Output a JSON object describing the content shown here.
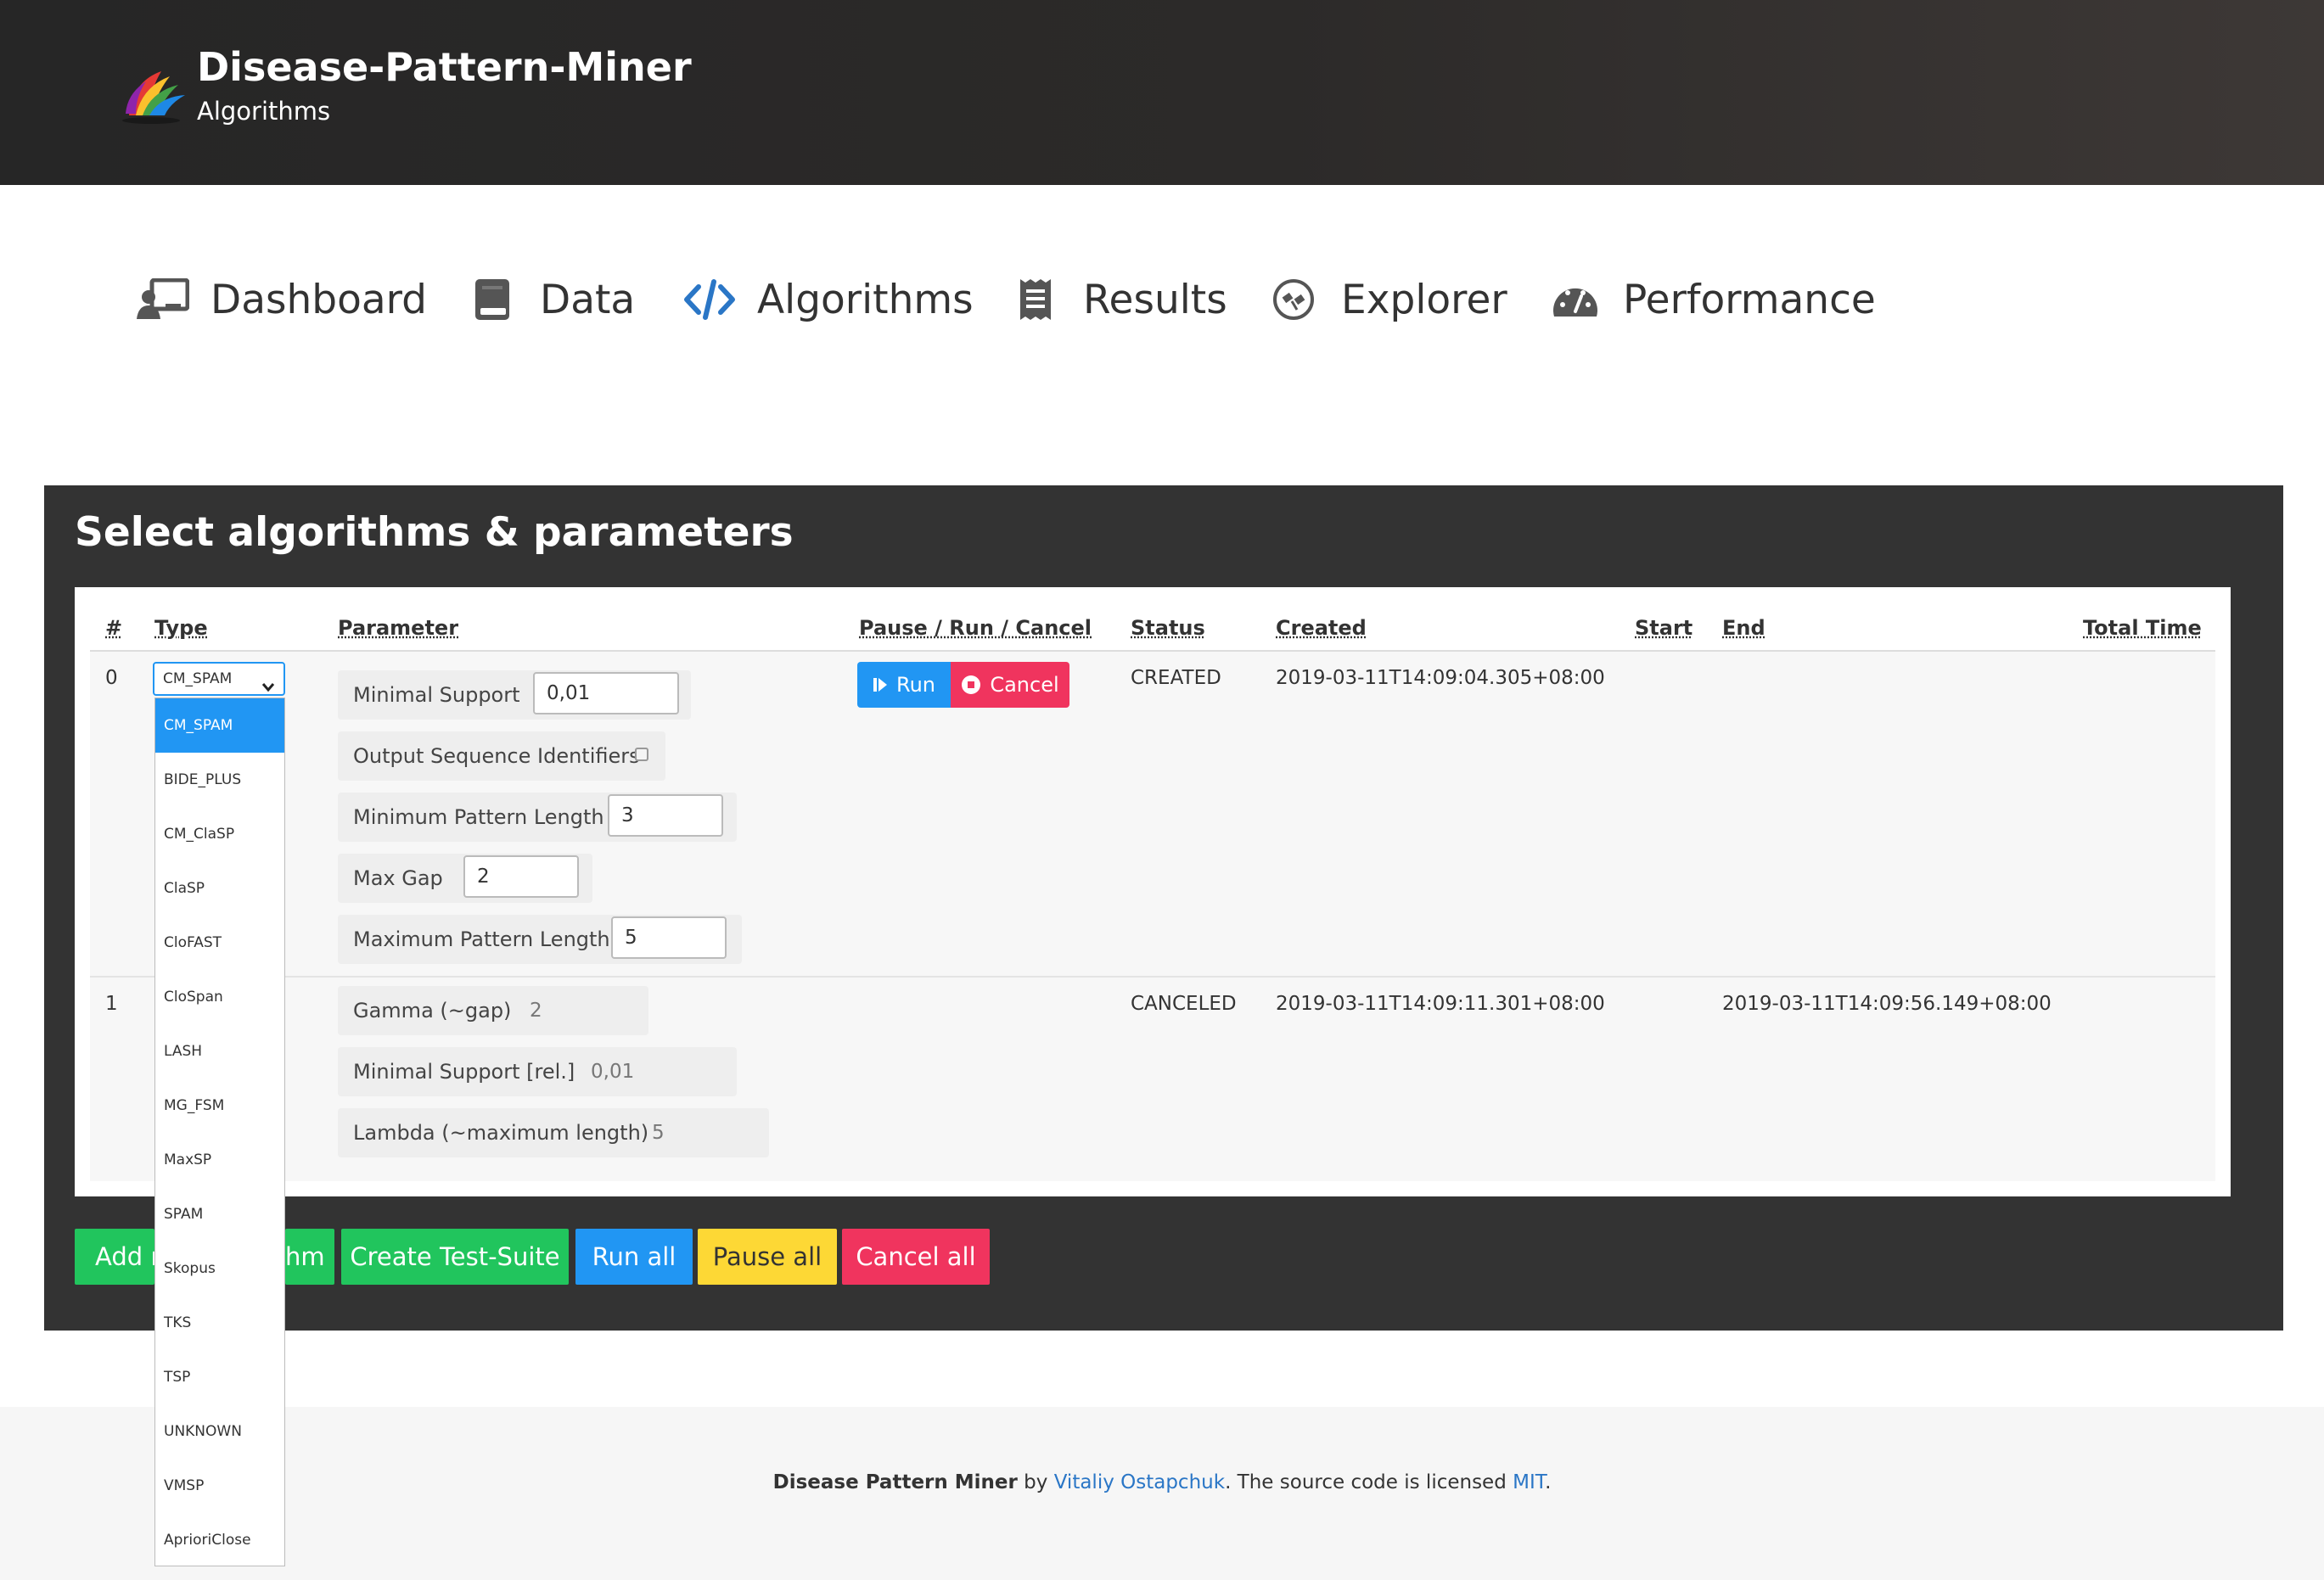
{
  "header": {
    "title": "Disease-Pattern-Miner",
    "subtitle": "Algorithms"
  },
  "nav": [
    {
      "label": "Dashboard",
      "icon": "dashboard-icon"
    },
    {
      "label": "Data",
      "icon": "book-icon"
    },
    {
      "label": "Algorithms",
      "icon": "code-icon",
      "active": true
    },
    {
      "label": "Results",
      "icon": "receipt-icon"
    },
    {
      "label": "Explorer",
      "icon": "satellite-icon"
    },
    {
      "label": "Performance",
      "icon": "speedometer-icon"
    }
  ],
  "panel": {
    "title": "Select algorithms & parameters"
  },
  "table": {
    "headers": [
      "#",
      "Type",
      "Parameter",
      "Pause / Run / Cancel",
      "Status",
      "Created",
      "Start",
      "End",
      "Total Time"
    ],
    "rows": [
      {
        "index": "0",
        "type": "CM_SPAM",
        "params": [
          {
            "label": "Minimal Support",
            "value": "0,01"
          },
          {
            "label": "Output Sequence Identifiers",
            "checked": false
          },
          {
            "label": "Minimum Pattern Length",
            "value": "3"
          },
          {
            "label": "Max Gap",
            "value": "2"
          },
          {
            "label": "Maximum Pattern Length",
            "value": "5"
          }
        ],
        "run_label": "Run",
        "cancel_label": "Cancel",
        "status": "CREATED",
        "created": "2019-03-11T14:09:04.305+08:00",
        "start": "",
        "end": "",
        "total_time": ""
      },
      {
        "index": "1",
        "params": [
          {
            "label": "Gamma (~gap)",
            "value": "2"
          },
          {
            "label": "Minimal Support [rel.]",
            "value": "0,01"
          },
          {
            "label": "Lambda (~maximum length)",
            "value": "5"
          }
        ],
        "status": "CANCELED",
        "created": "2019-03-11T14:09:11.301+08:00",
        "start": "",
        "end": "2019-03-11T14:09:56.149+08:00",
        "total_time": ""
      }
    ]
  },
  "dropdown": {
    "selected": "CM_SPAM",
    "options": [
      "CM_SPAM",
      "BIDE_PLUS",
      "CM_ClaSP",
      "ClaSP",
      "CloFAST",
      "CloSpan",
      "LASH",
      "MG_FSM",
      "MaxSP",
      "SPAM",
      "Skopus",
      "TKS",
      "TSP",
      "UNKNOWN",
      "VMSP",
      "AprioriClose"
    ]
  },
  "actions": {
    "add_visible_left": "Add r",
    "add_visible_right": "hm",
    "create_test_suite": "Create Test-Suite",
    "run_all": "Run all",
    "pause_all": "Pause all",
    "cancel_all": "Cancel all"
  },
  "colors": {
    "primary": "#2196f3",
    "success": "#21c55d",
    "warning": "#fdd835",
    "danger": "#f0345e",
    "panel": "#333333",
    "link": "#2a76c6"
  },
  "footer": {
    "app": "Disease Pattern Miner",
    "by": "by",
    "author": "Vitaliy Ostapchuk",
    "license_text": ". The source code is licensed",
    "license": "MIT",
    "end": "."
  }
}
